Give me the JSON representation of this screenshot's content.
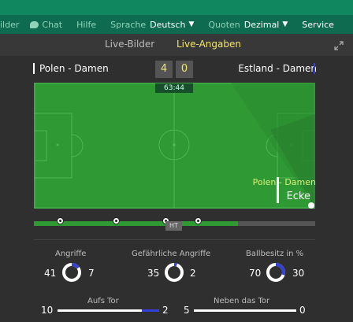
{
  "nav": {
    "bilder": "ilder",
    "chat": "Chat",
    "hilfe": "Hilfe",
    "sprache_label": "Sprache",
    "sprache_value": "Deutsch",
    "quoten_label": "Quoten",
    "quoten_value": "Dezimal",
    "service": "Service"
  },
  "tabs": {
    "live_bilder": "Live-Bilder",
    "live_angaben": "Live-Angaben"
  },
  "match": {
    "home": "Polen - Damen",
    "away": "Estland - Damen",
    "home_score": "4",
    "away_score": "0",
    "clock": "63:44",
    "event_team": "Polen - Damen",
    "event_type": "Ecke",
    "half_label": "HT"
  },
  "stats": {
    "angriffe": {
      "label": "Angriffe",
      "home": "41",
      "away": "7"
    },
    "gef_angriffe": {
      "label": "Gefährliche Angriffe",
      "home": "35",
      "away": "2"
    },
    "ballbesitz": {
      "label": "Ballbesitz in %",
      "home": "70",
      "away": "30"
    },
    "aufs_tor": {
      "label": "Aufs Tor",
      "home": "10",
      "away": "2"
    },
    "neben_tor": {
      "label": "Neben das Tor",
      "home": "5",
      "away": "0"
    }
  },
  "colors": {
    "home": "#ffffff",
    "away": "#3540d8",
    "pitch": "#2f9934",
    "accent": "#f3e66b"
  }
}
